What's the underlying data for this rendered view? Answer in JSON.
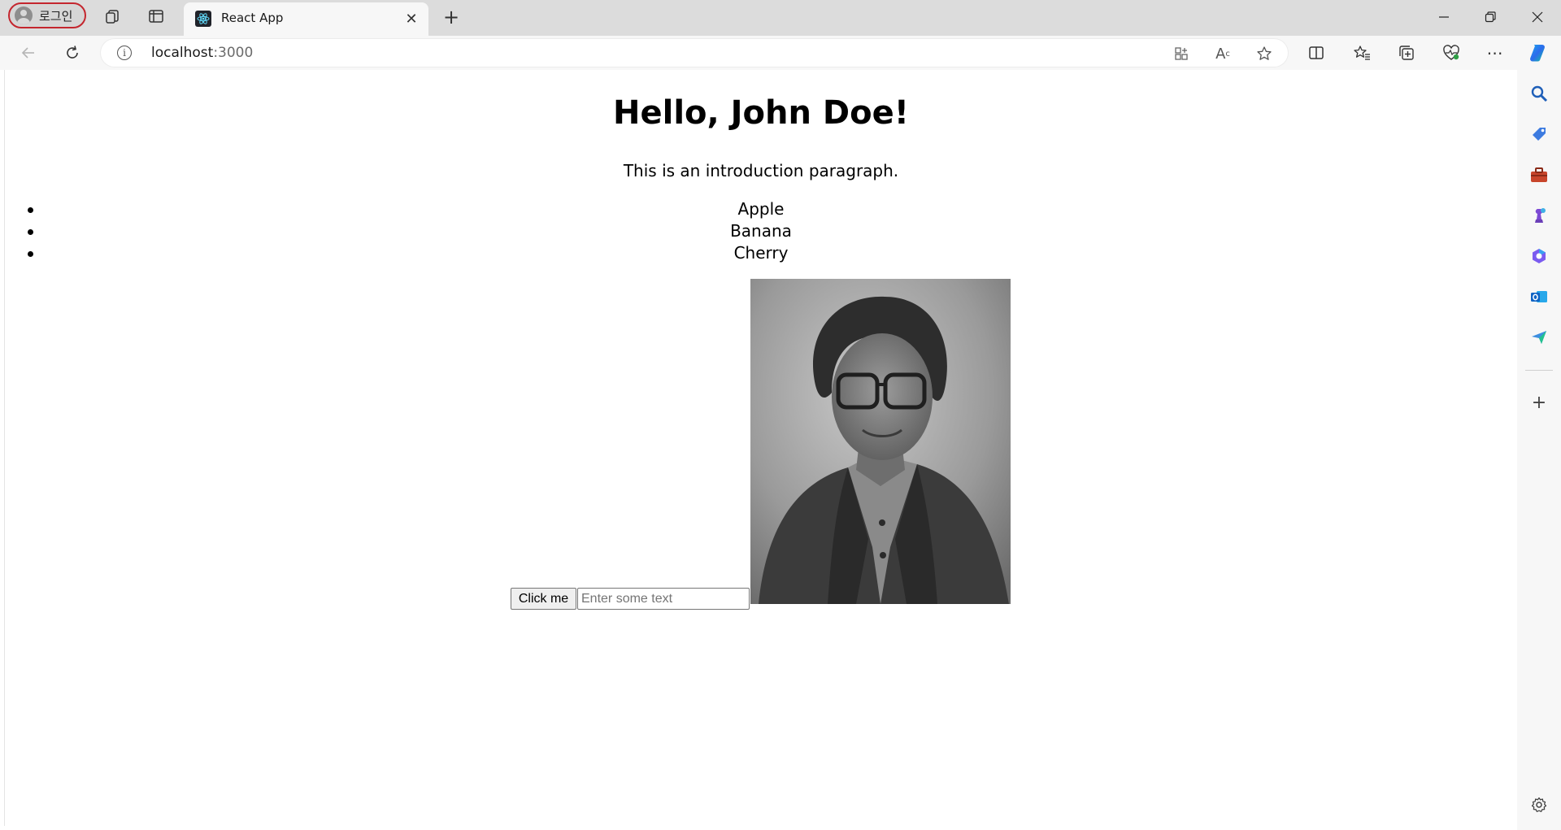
{
  "browser": {
    "profile_label": "로그인",
    "tab": {
      "title": "React App"
    },
    "address": {
      "host": "localhost",
      "port": ":3000"
    },
    "icons": [
      "workspaces-icon",
      "vertical-tabs-icon",
      "back-icon",
      "refresh-icon",
      "info-icon",
      "app-available-icon",
      "read-aloud-icon",
      "favorite-icon",
      "split-screen-icon",
      "favorites-icon",
      "collections-icon",
      "browser-essentials-icon",
      "more-icon",
      "copilot-icon"
    ],
    "sidebar_icons": [
      "search-icon",
      "shopping-icon",
      "tools-icon",
      "games-icon",
      "m365-icon",
      "outlook-icon",
      "send-icon",
      "add-icon",
      "settings-icon"
    ]
  },
  "page": {
    "heading": "Hello, John Doe!",
    "intro": "This is an introduction paragraph.",
    "list": [
      "Apple",
      "Banana",
      "Cherry"
    ],
    "button_label": "Click me",
    "input": {
      "placeholder": "Enter some text",
      "value": ""
    }
  },
  "colors": {
    "accent": "#0c59a4",
    "profile_ring": "#c4262e"
  }
}
